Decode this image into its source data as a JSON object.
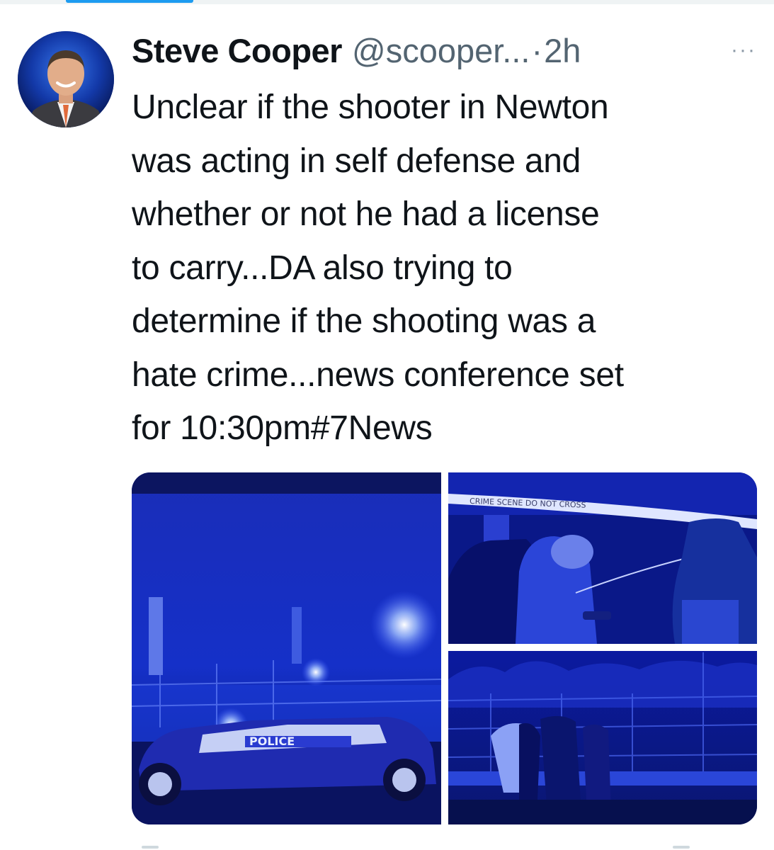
{
  "tweet": {
    "author": {
      "display_name": "Steve Cooper",
      "handle": "@scooper...",
      "avatar_icon": "profile-photo"
    },
    "separator": "·",
    "timestamp": "2h",
    "more_icon": "more-dots-icon",
    "more_label": "···",
    "text_lines": [
      "Unclear if the shooter in Newton",
      "was acting in self defense and",
      "whether or not he had a license",
      "to carry...DA also trying to",
      "determine if the shooting was a",
      "hate crime...news conference set",
      "for 10:30pm#7News"
    ],
    "media": [
      {
        "kind": "photo",
        "visible_text": "POLICE"
      },
      {
        "kind": "photo",
        "visible_text": "CRIME SCENE DO NOT CROSS"
      },
      {
        "kind": "photo",
        "visible_text": ""
      }
    ]
  },
  "colors": {
    "accent": "#1d9bf0",
    "text_primary": "#0f1419",
    "text_secondary": "#536471"
  }
}
